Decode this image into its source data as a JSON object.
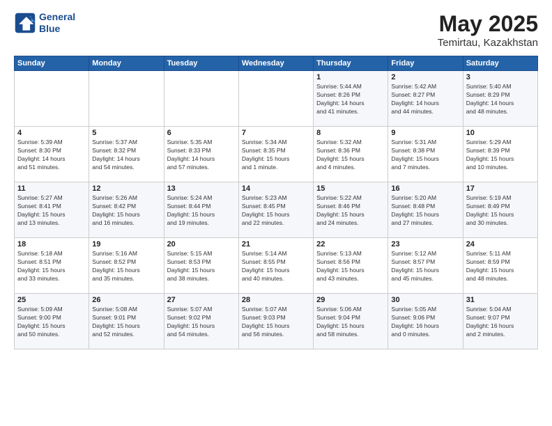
{
  "header": {
    "logo_line1": "General",
    "logo_line2": "Blue",
    "month": "May 2025",
    "location": "Temirtau, Kazakhstan"
  },
  "weekdays": [
    "Sunday",
    "Monday",
    "Tuesday",
    "Wednesday",
    "Thursday",
    "Friday",
    "Saturday"
  ],
  "weeks": [
    [
      {
        "day": "",
        "detail": ""
      },
      {
        "day": "",
        "detail": ""
      },
      {
        "day": "",
        "detail": ""
      },
      {
        "day": "",
        "detail": ""
      },
      {
        "day": "1",
        "detail": "Sunrise: 5:44 AM\nSunset: 8:26 PM\nDaylight: 14 hours\nand 41 minutes."
      },
      {
        "day": "2",
        "detail": "Sunrise: 5:42 AM\nSunset: 8:27 PM\nDaylight: 14 hours\nand 44 minutes."
      },
      {
        "day": "3",
        "detail": "Sunrise: 5:40 AM\nSunset: 8:29 PM\nDaylight: 14 hours\nand 48 minutes."
      }
    ],
    [
      {
        "day": "4",
        "detail": "Sunrise: 5:39 AM\nSunset: 8:30 PM\nDaylight: 14 hours\nand 51 minutes."
      },
      {
        "day": "5",
        "detail": "Sunrise: 5:37 AM\nSunset: 8:32 PM\nDaylight: 14 hours\nand 54 minutes."
      },
      {
        "day": "6",
        "detail": "Sunrise: 5:35 AM\nSunset: 8:33 PM\nDaylight: 14 hours\nand 57 minutes."
      },
      {
        "day": "7",
        "detail": "Sunrise: 5:34 AM\nSunset: 8:35 PM\nDaylight: 15 hours\nand 1 minute."
      },
      {
        "day": "8",
        "detail": "Sunrise: 5:32 AM\nSunset: 8:36 PM\nDaylight: 15 hours\nand 4 minutes."
      },
      {
        "day": "9",
        "detail": "Sunrise: 5:31 AM\nSunset: 8:38 PM\nDaylight: 15 hours\nand 7 minutes."
      },
      {
        "day": "10",
        "detail": "Sunrise: 5:29 AM\nSunset: 8:39 PM\nDaylight: 15 hours\nand 10 minutes."
      }
    ],
    [
      {
        "day": "11",
        "detail": "Sunrise: 5:27 AM\nSunset: 8:41 PM\nDaylight: 15 hours\nand 13 minutes."
      },
      {
        "day": "12",
        "detail": "Sunrise: 5:26 AM\nSunset: 8:42 PM\nDaylight: 15 hours\nand 16 minutes."
      },
      {
        "day": "13",
        "detail": "Sunrise: 5:24 AM\nSunset: 8:44 PM\nDaylight: 15 hours\nand 19 minutes."
      },
      {
        "day": "14",
        "detail": "Sunrise: 5:23 AM\nSunset: 8:45 PM\nDaylight: 15 hours\nand 22 minutes."
      },
      {
        "day": "15",
        "detail": "Sunrise: 5:22 AM\nSunset: 8:46 PM\nDaylight: 15 hours\nand 24 minutes."
      },
      {
        "day": "16",
        "detail": "Sunrise: 5:20 AM\nSunset: 8:48 PM\nDaylight: 15 hours\nand 27 minutes."
      },
      {
        "day": "17",
        "detail": "Sunrise: 5:19 AM\nSunset: 8:49 PM\nDaylight: 15 hours\nand 30 minutes."
      }
    ],
    [
      {
        "day": "18",
        "detail": "Sunrise: 5:18 AM\nSunset: 8:51 PM\nDaylight: 15 hours\nand 33 minutes."
      },
      {
        "day": "19",
        "detail": "Sunrise: 5:16 AM\nSunset: 8:52 PM\nDaylight: 15 hours\nand 35 minutes."
      },
      {
        "day": "20",
        "detail": "Sunrise: 5:15 AM\nSunset: 8:53 PM\nDaylight: 15 hours\nand 38 minutes."
      },
      {
        "day": "21",
        "detail": "Sunrise: 5:14 AM\nSunset: 8:55 PM\nDaylight: 15 hours\nand 40 minutes."
      },
      {
        "day": "22",
        "detail": "Sunrise: 5:13 AM\nSunset: 8:56 PM\nDaylight: 15 hours\nand 43 minutes."
      },
      {
        "day": "23",
        "detail": "Sunrise: 5:12 AM\nSunset: 8:57 PM\nDaylight: 15 hours\nand 45 minutes."
      },
      {
        "day": "24",
        "detail": "Sunrise: 5:11 AM\nSunset: 8:59 PM\nDaylight: 15 hours\nand 48 minutes."
      }
    ],
    [
      {
        "day": "25",
        "detail": "Sunrise: 5:09 AM\nSunset: 9:00 PM\nDaylight: 15 hours\nand 50 minutes."
      },
      {
        "day": "26",
        "detail": "Sunrise: 5:08 AM\nSunset: 9:01 PM\nDaylight: 15 hours\nand 52 minutes."
      },
      {
        "day": "27",
        "detail": "Sunrise: 5:07 AM\nSunset: 9:02 PM\nDaylight: 15 hours\nand 54 minutes."
      },
      {
        "day": "28",
        "detail": "Sunrise: 5:07 AM\nSunset: 9:03 PM\nDaylight: 15 hours\nand 56 minutes."
      },
      {
        "day": "29",
        "detail": "Sunrise: 5:06 AM\nSunset: 9:04 PM\nDaylight: 15 hours\nand 58 minutes."
      },
      {
        "day": "30",
        "detail": "Sunrise: 5:05 AM\nSunset: 9:06 PM\nDaylight: 16 hours\nand 0 minutes."
      },
      {
        "day": "31",
        "detail": "Sunrise: 5:04 AM\nSunset: 9:07 PM\nDaylight: 16 hours\nand 2 minutes."
      }
    ]
  ]
}
